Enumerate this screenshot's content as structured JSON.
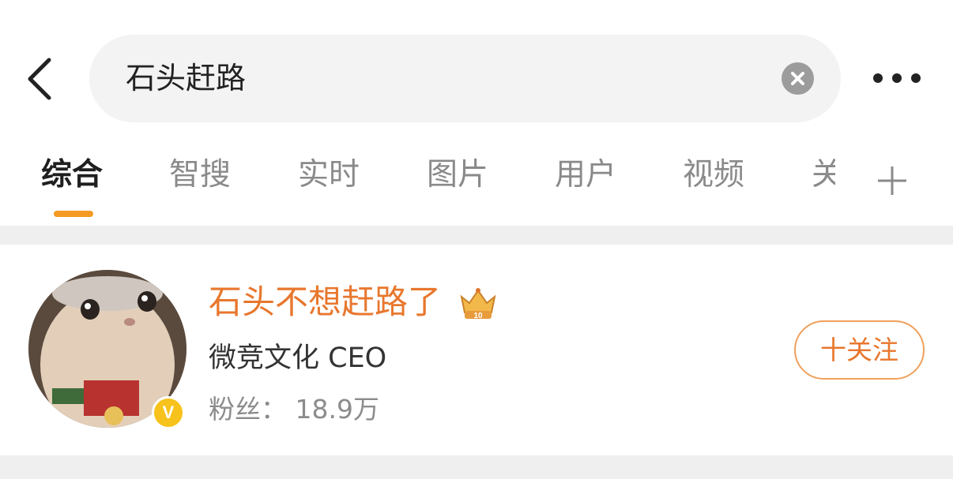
{
  "search": {
    "query": "石头赶路"
  },
  "tabs": [
    {
      "label": "综合",
      "active": true
    },
    {
      "label": "智搜"
    },
    {
      "label": "实时"
    },
    {
      "label": "图片"
    },
    {
      "label": "用户"
    },
    {
      "label": "视频"
    },
    {
      "label": "关"
    }
  ],
  "user_card": {
    "name": "石头不想赶路了",
    "badge_level": "10",
    "description": "微竞文化 CEO",
    "followers": "粉丝： 18.9万",
    "follow_button": "十关注",
    "verified_mark": "V"
  },
  "colors": {
    "accent_orange": "#e8772e",
    "tab_indicator": "#f59a23",
    "verify_badge": "#f7c21b"
  },
  "icons": [
    "back-arrow-icon",
    "clear-icon",
    "more-icon",
    "add-tab-icon",
    "crown-badge-icon",
    "verified-badge-icon"
  ]
}
